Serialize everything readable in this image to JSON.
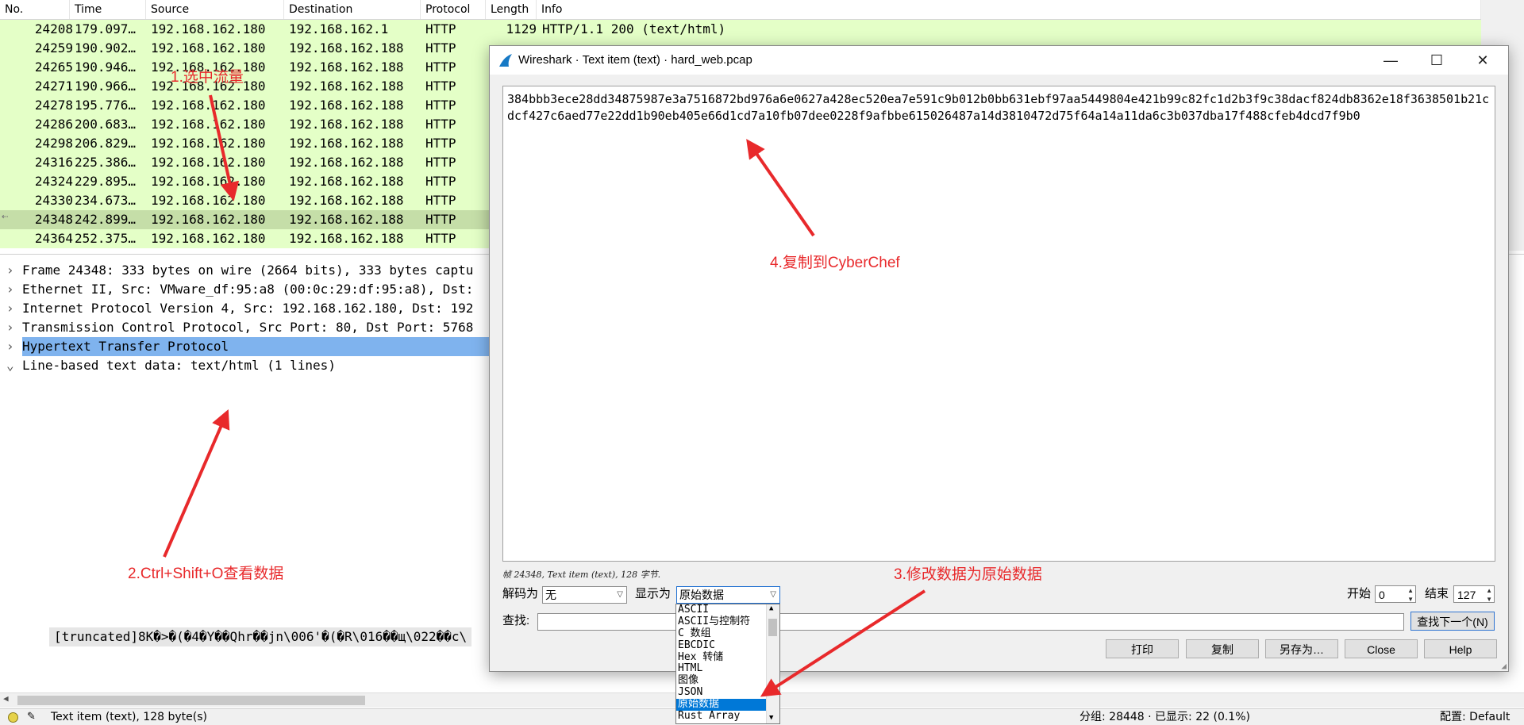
{
  "packet_list": {
    "columns": [
      "No.",
      "Time",
      "Source",
      "Destination",
      "Protocol",
      "Length",
      "Info"
    ],
    "rows": [
      {
        "no": "24208",
        "time": "179.097…",
        "src": "192.168.162.180",
        "dst": "192.168.162.1",
        "proto": "HTTP",
        "len": "1129",
        "info": "HTTP/1.1 200   (text/html)"
      },
      {
        "no": "24259",
        "time": "190.902…",
        "src": "192.168.162.180",
        "dst": "192.168.162.188",
        "proto": "HTTP",
        "len": "",
        "info": ""
      },
      {
        "no": "24265",
        "time": "190.946…",
        "src": "192.168.162.180",
        "dst": "192.168.162.188",
        "proto": "HTTP",
        "len": "",
        "info": ""
      },
      {
        "no": "24271",
        "time": "190.966…",
        "src": "192.168.162.180",
        "dst": "192.168.162.188",
        "proto": "HTTP",
        "len": "",
        "info": ""
      },
      {
        "no": "24278",
        "time": "195.776…",
        "src": "192.168.162.180",
        "dst": "192.168.162.188",
        "proto": "HTTP",
        "len": "",
        "info": ""
      },
      {
        "no": "24286",
        "time": "200.683…",
        "src": "192.168.162.180",
        "dst": "192.168.162.188",
        "proto": "HTTP",
        "len": "",
        "info": ""
      },
      {
        "no": "24298",
        "time": "206.829…",
        "src": "192.168.162.180",
        "dst": "192.168.162.188",
        "proto": "HTTP",
        "len": "",
        "info": ""
      },
      {
        "no": "24316",
        "time": "225.386…",
        "src": "192.168.162.180",
        "dst": "192.168.162.188",
        "proto": "HTTP",
        "len": "",
        "info": ""
      },
      {
        "no": "24324",
        "time": "229.895…",
        "src": "192.168.162.180",
        "dst": "192.168.162.188",
        "proto": "HTTP",
        "len": "",
        "info": ""
      },
      {
        "no": "24330",
        "time": "234.673…",
        "src": "192.168.162.180",
        "dst": "192.168.162.188",
        "proto": "HTTP",
        "len": "",
        "info": ""
      },
      {
        "no": "24348",
        "time": "242.899…",
        "src": "192.168.162.180",
        "dst": "192.168.162.188",
        "proto": "HTTP",
        "len": "",
        "info": "",
        "selected": true
      },
      {
        "no": "24364",
        "time": "252.375…",
        "src": "192.168.162.180",
        "dst": "192.168.162.188",
        "proto": "HTTP",
        "len": "",
        "info": ""
      }
    ],
    "row_color": "#e4ffc7",
    "selected_row_color": "#c5dea8"
  },
  "details": {
    "items": [
      {
        "arrow": ">",
        "text": "Frame 24348: 333 bytes on wire (2664 bits), 333 bytes captu"
      },
      {
        "arrow": ">",
        "text": "Ethernet II, Src: VMware_df:95:a8 (00:0c:29:df:95:a8), Dst:"
      },
      {
        "arrow": ">",
        "text": "Internet Protocol Version 4, Src: 192.168.162.180, Dst: 192"
      },
      {
        "arrow": ">",
        "text": "Transmission Control Protocol, Src Port: 80, Dst Port: 5768"
      },
      {
        "arrow": ">",
        "text": "Hypertext Transfer Protocol"
      },
      {
        "arrow": "v",
        "text": "Line-based text data: text/html (1 lines)"
      }
    ],
    "truncated_line": "[truncated]8K�>�(�4�Y��Qhr��jn\\006'�(�R\\016��щ\\022��c\\"
  },
  "status_bar": {
    "left_text": "Text item (text), 128 byte(s)",
    "packets": "分组: 28448 · 已显示: 22 (0.1%)",
    "profile": "配置: Default"
  },
  "dialog": {
    "title": "Wireshark · Text item (text) · hard_web.pcap",
    "content": "384bbb3ece28dd34875987e3a7516872bd976a6e0627a428ec520ea7e591c9b012b0bb631ebf97aa5449804e421b99c82fc1d2b3f9c38dacf824db8362e18f3638501b21cdcf427c6aed77e22dd1b90eb405e66d1cd7a10fb07dee0228f9afbbe615026487a14d3810472d75f64a14a11da6c3b037dba17f488cfeb4dcd7f9b0",
    "frame_info": "帧 24348, Text item (text), 128 字节.",
    "decode_label": "解码为",
    "decode_value": "无",
    "show_label": "显示为",
    "show_value": "原始数据",
    "start_label": "开始",
    "start_value": "0",
    "end_label": "结束",
    "end_value": "127",
    "find_label": "查找:",
    "find_next": "查找下一个(N)",
    "buttons": {
      "print": "打印",
      "copy": "复制",
      "save_as": "另存为…",
      "close": "Close",
      "help": "Help"
    },
    "dropdown_options": [
      "ASCII",
      "ASCII与控制符",
      "C 数组",
      "EBCDIC",
      "Hex 转储",
      "HTML",
      "图像",
      "JSON",
      "原始数据",
      "Rust Array"
    ],
    "dropdown_selected_index": 8,
    "window_buttons": {
      "minimize": "—",
      "maximize": "☐",
      "close": "✕"
    }
  },
  "annotations": {
    "step1": "1.选中流量",
    "step2": "2.Ctrl+Shift+O查看数据",
    "step3": "3.修改数据为原始数据",
    "step4": "4.复制到CyberChef",
    "color": "#e8292b"
  }
}
